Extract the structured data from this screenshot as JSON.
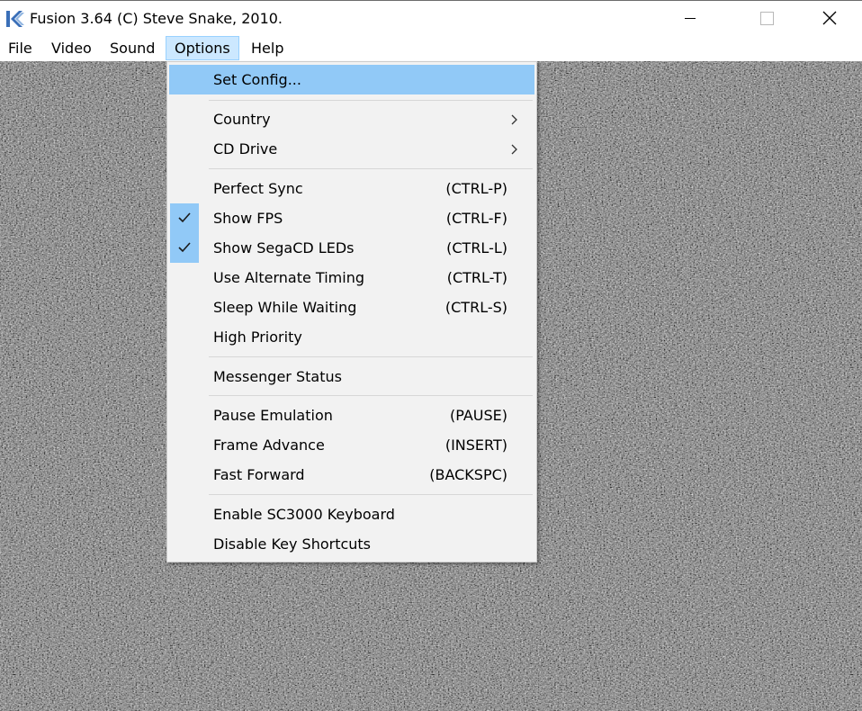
{
  "window": {
    "title": "Fusion 3.64 (C) Steve Snake, 2010.",
    "icon": "fusion-app-icon"
  },
  "menubar": {
    "items": [
      {
        "label": "File"
      },
      {
        "label": "Video"
      },
      {
        "label": "Sound"
      },
      {
        "label": "Options"
      },
      {
        "label": "Help"
      }
    ],
    "open_item": "Options"
  },
  "options_menu": {
    "set_config": "Set Config...",
    "country": "Country",
    "cd_drive": "CD Drive",
    "perfect_sync": {
      "label": "Perfect Sync",
      "shortcut": "(CTRL-P)",
      "checked": false
    },
    "show_fps": {
      "label": "Show FPS",
      "shortcut": "(CTRL-F)",
      "checked": true
    },
    "show_segacd_leds": {
      "label": "Show SegaCD LEDs",
      "shortcut": "(CTRL-L)",
      "checked": true
    },
    "use_alternate_timing": {
      "label": "Use Alternate Timing",
      "shortcut": "(CTRL-T)",
      "checked": false
    },
    "sleep_while_waiting": {
      "label": "Sleep While Waiting",
      "shortcut": "(CTRL-S)",
      "checked": false
    },
    "high_priority": {
      "label": "High Priority",
      "checked": false
    },
    "messenger_status": "Messenger Status",
    "pause_emulation": {
      "label": "Pause Emulation",
      "shortcut": "(PAUSE)"
    },
    "frame_advance": {
      "label": "Frame Advance",
      "shortcut": "(INSERT)"
    },
    "fast_forward": {
      "label": "Fast Forward",
      "shortcut": "(BACKSPC)"
    },
    "enable_sc3000_keyboard": "Enable SC3000 Keyboard",
    "disable_key_shortcuts": "Disable Key Shortcuts",
    "highlighted_item": "Set Config..."
  },
  "colors": {
    "menu_highlight": "#91c9f7",
    "menubar_open": "#cce8ff",
    "menu_background": "#f2f2f2",
    "static_noise": "#777777"
  }
}
